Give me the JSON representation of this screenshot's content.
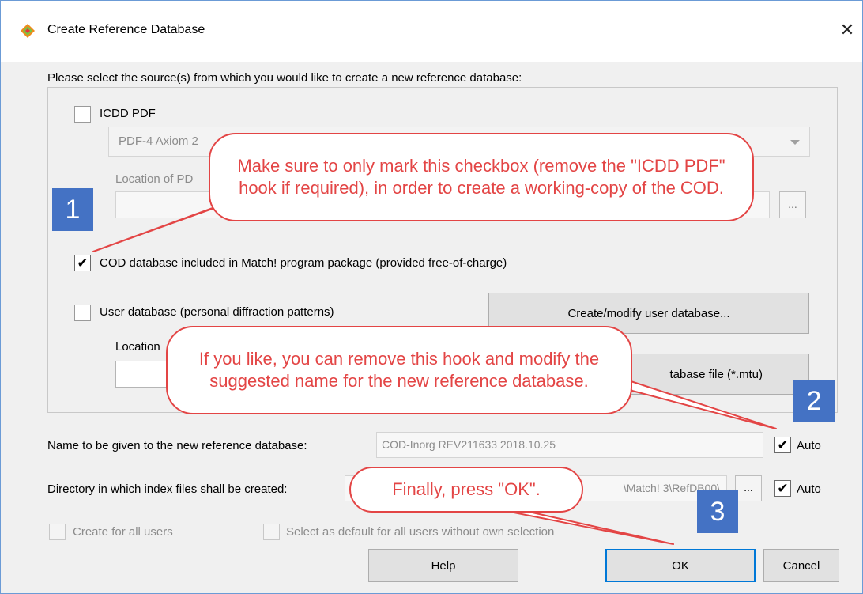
{
  "window": {
    "title": "Create Reference Database",
    "close_glyph": "✕",
    "icon": "diamond-app-icon"
  },
  "instructions": "Please select the source(s) from which you would like to create a new reference database:",
  "sources": {
    "icdd": {
      "label": "ICDD PDF",
      "checked": false,
      "combo_value": "PDF-4 Axiom 2",
      "location_label": "Location of PD",
      "browse_label": "..."
    },
    "cod": {
      "label": "COD database included in Match! program package (provided free-of-charge)",
      "checked": true,
      "check_glyph": "✔"
    },
    "user": {
      "label": "User database (personal diffraction patterns)",
      "checked": false,
      "create_button": "Create/modify user database...",
      "location_label": "Location",
      "open_button": "tabase file (*.mtu)"
    }
  },
  "name_row": {
    "label": "Name to be given to the new reference database:",
    "value": "COD-Inorg REV211633 2018.10.25",
    "auto_label": "Auto",
    "auto_checked": true
  },
  "dir_row": {
    "label": "Directory in which index files shall be created:",
    "value": "\\Match! 3\\RefDB00\\",
    "browse_label": "...",
    "auto_label": "Auto",
    "auto_checked": true
  },
  "options": {
    "all_users": "Create for all users",
    "default_all": "Select as default for all users without own selection"
  },
  "buttons": {
    "help": "Help",
    "ok": "OK",
    "cancel": "Cancel"
  },
  "callouts": [
    {
      "step": "1",
      "text": "Make sure to only mark this checkbox (remove the \"ICDD PDF\" hook if required), in order to create a working-copy of the COD."
    },
    {
      "step": "2",
      "text": "If you like, you can remove this hook and modify the suggested name for the new reference database."
    },
    {
      "step": "3",
      "text": "Finally, press \"OK\"."
    }
  ],
  "colors": {
    "callout": "#e34545",
    "badge": "#4472c4",
    "default_button_border": "#0078d7"
  }
}
